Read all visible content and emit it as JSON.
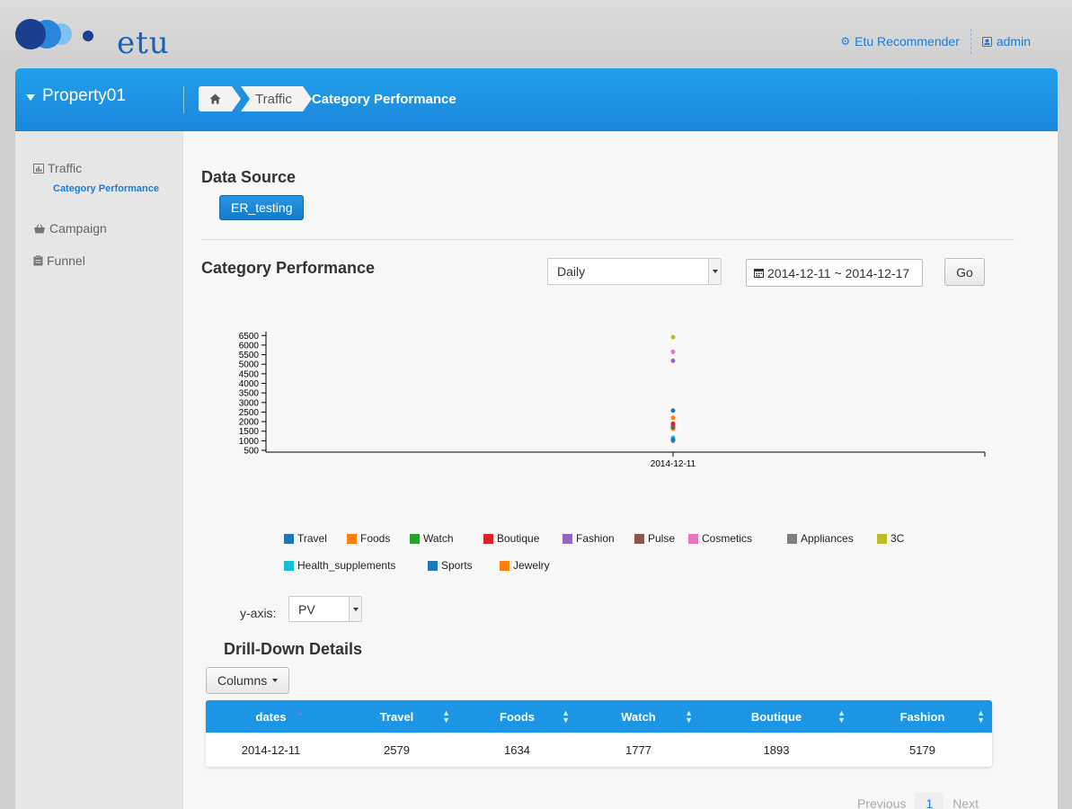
{
  "brand": {
    "logo_text": "etu"
  },
  "top_links": {
    "recommender": "Etu Recommender",
    "admin": "admin"
  },
  "header": {
    "property": "Property01",
    "breadcrumb": {
      "traffic": "Traffic",
      "current": "Category Performance"
    }
  },
  "sidebar": {
    "traffic": "Traffic",
    "category_performance": "Category Performance",
    "campaign": "Campaign",
    "funnel": "Funnel"
  },
  "data_source": {
    "title": "Data Source",
    "button": "ER_testing"
  },
  "category": {
    "title": "Category Performance",
    "interval": "Daily",
    "date_range": "2014-12-11 ~ 2014-12-17",
    "go": "Go"
  },
  "chart_data": {
    "type": "scatter",
    "x": [
      "2014-12-11"
    ],
    "ylim": [
      500,
      6700
    ],
    "yticks": [
      500,
      1000,
      1500,
      2000,
      2500,
      3000,
      3500,
      4000,
      4500,
      5000,
      5500,
      6000,
      6500
    ],
    "series": [
      {
        "name": "Travel",
        "color": "#1f77b4",
        "values": [
          2579
        ]
      },
      {
        "name": "Foods",
        "color": "#ff7f0e",
        "values": [
          1634
        ]
      },
      {
        "name": "Watch",
        "color": "#2ca02c",
        "values": [
          1777
        ]
      },
      {
        "name": "Boutique",
        "color": "#d62728",
        "values": [
          1893
        ]
      },
      {
        "name": "Fashion",
        "color": "#9467bd",
        "values": [
          5179
        ]
      },
      {
        "name": "Pulse",
        "color": "#8c564b",
        "values": [
          1700
        ]
      },
      {
        "name": "Cosmetics",
        "color": "#e377c2",
        "values": [
          5650
        ]
      },
      {
        "name": "Appliances",
        "color": "#7f7f7f",
        "values": [
          1000
        ]
      },
      {
        "name": "3C",
        "color": "#bcbd22",
        "values": [
          6420
        ]
      },
      {
        "name": "Health_supplements",
        "color": "#17becf",
        "values": [
          1150
        ]
      },
      {
        "name": "Sports",
        "color": "#1f77b4",
        "values": [
          1050
        ]
      },
      {
        "name": "Jewelry",
        "color": "#ff7f0e",
        "values": [
          2200
        ]
      }
    ]
  },
  "yaxis": {
    "label": "y-axis:",
    "value": "PV"
  },
  "drilldown": {
    "title": "Drill-Down Details",
    "columns_button": "Columns",
    "headers": [
      "dates",
      "Travel",
      "Foods",
      "Watch",
      "Boutique",
      "Fashion"
    ],
    "rows": [
      [
        "2014-12-11",
        "2579",
        "1634",
        "1777",
        "1893",
        "5179"
      ]
    ]
  },
  "pager": {
    "previous": "Previous",
    "page": "1",
    "next": "Next"
  }
}
